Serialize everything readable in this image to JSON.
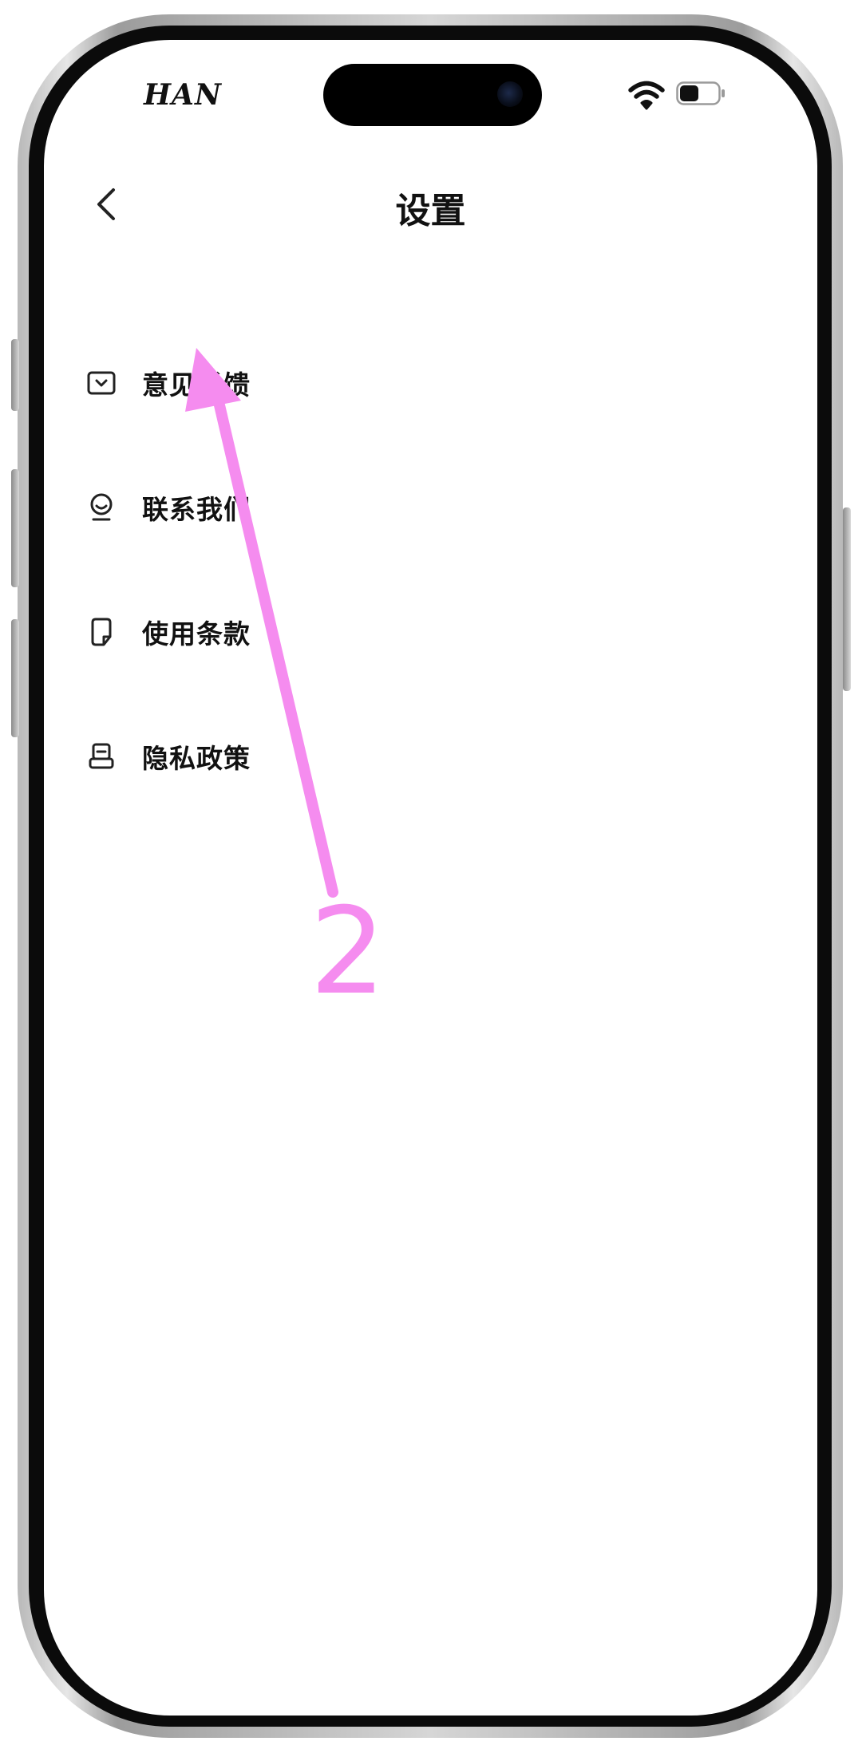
{
  "status_bar": {
    "brand": "HAN",
    "wifi_icon": "wifi-icon",
    "battery_icon": "battery-icon",
    "battery_level": 0.5
  },
  "header": {
    "back_icon": "chevron-left-icon",
    "title": "设置"
  },
  "menu": {
    "items": [
      {
        "label": "意见反馈",
        "icon": "feedback-icon"
      },
      {
        "label": "联系我们",
        "icon": "contact-icon"
      },
      {
        "label": "使用条款",
        "icon": "terms-icon"
      },
      {
        "label": "隐私政策",
        "icon": "privacy-icon"
      }
    ]
  },
  "annotation": {
    "step_number": "2",
    "color": "#f58cef"
  },
  "colors": {
    "text": "#111111",
    "background": "#ffffff",
    "annotation": "#f58cef"
  }
}
